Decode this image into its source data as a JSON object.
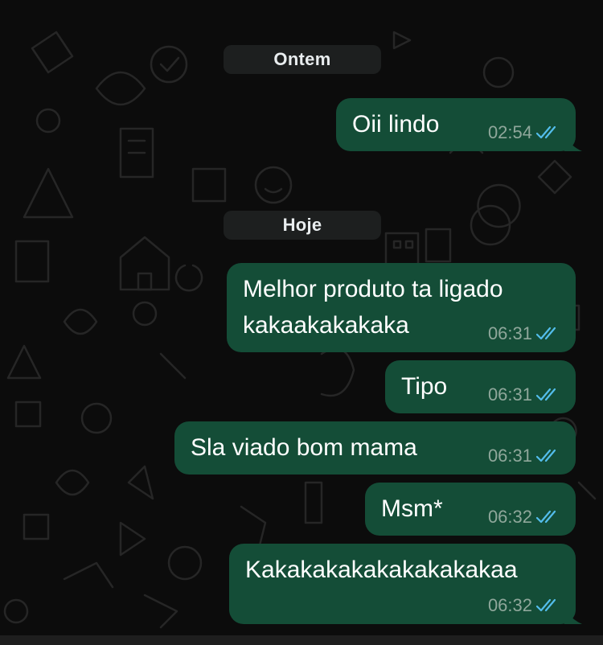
{
  "colors": {
    "background": "#0c0c0c",
    "bubble_out": "#144d37",
    "date_pill": "#1d1f1f",
    "read_ticks": "#53bdeb",
    "timestamp": "#8fa79b"
  },
  "dates": {
    "yesterday": "Ontem",
    "today": "Hoje"
  },
  "messages": [
    {
      "text": "Oii lindo",
      "time": "02:54",
      "status": "read-double-check-icon"
    },
    {
      "text": "Melhor produto ta ligado\nkakaakakakaka",
      "time": "06:31",
      "status": "read-double-check-icon"
    },
    {
      "text": "Tipo",
      "time": "06:31",
      "status": "read-double-check-icon"
    },
    {
      "text": "Sla viado bom mama",
      "time": "06:31",
      "status": "read-double-check-icon"
    },
    {
      "text": "Msm*",
      "time": "06:32",
      "status": "read-double-check-icon"
    },
    {
      "text": "Kakakakakakakakakakaa",
      "time": "06:32",
      "status": "read-double-check-icon"
    }
  ]
}
